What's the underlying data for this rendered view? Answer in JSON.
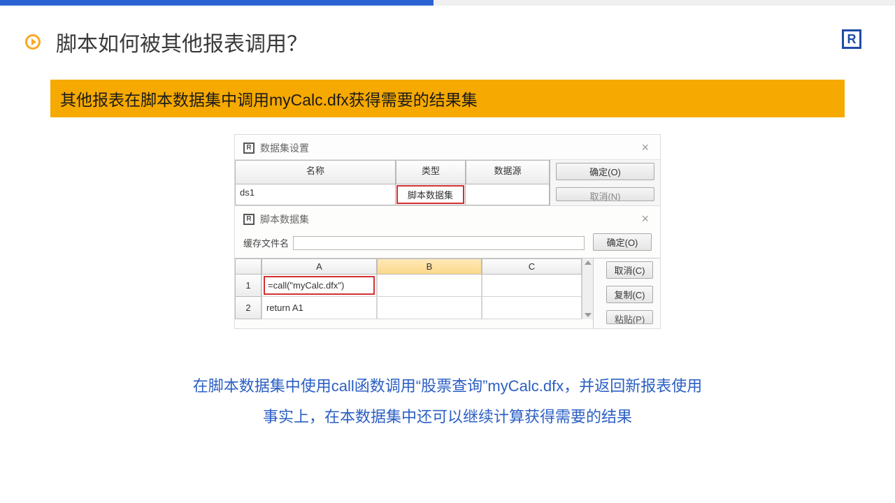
{
  "title": "脚本如何被其他报表调用？",
  "banner": "其他报表在脚本数据集中调用myCalc.dfx获得需要的结果集",
  "logo_letter": "R",
  "outer_dialog": {
    "title": "数据集设置",
    "headers": {
      "name": "名称",
      "type": "类型",
      "source": "数据源"
    },
    "row": {
      "name": "ds1",
      "type": "脚本数据集",
      "source": ""
    },
    "btn_ok": "确定(O)",
    "btn_cancel_cut": "取消(N)"
  },
  "inner_dialog": {
    "title": "脚本数据集",
    "cache_label": "缓存文件名",
    "btn_ok": "确定(O)",
    "btn_cancel": "取消(C)",
    "btn_copy": "复制(C)",
    "btn_paste_cut": "粘贴(P)",
    "cols": {
      "A": "A",
      "B": "B",
      "C": "C"
    },
    "rows": [
      {
        "n": "1",
        "A": "=call(\"myCalc.dfx\")",
        "B": "",
        "C": ""
      },
      {
        "n": "2",
        "A": "return A1",
        "B": "",
        "C": ""
      }
    ]
  },
  "explain_line1": "在脚本数据集中使用call函数调用“股票查询”myCalc.dfx，并返回新报表使用",
  "explain_line2": "事实上，在本数据集中还可以继续计算获得需要的结果"
}
